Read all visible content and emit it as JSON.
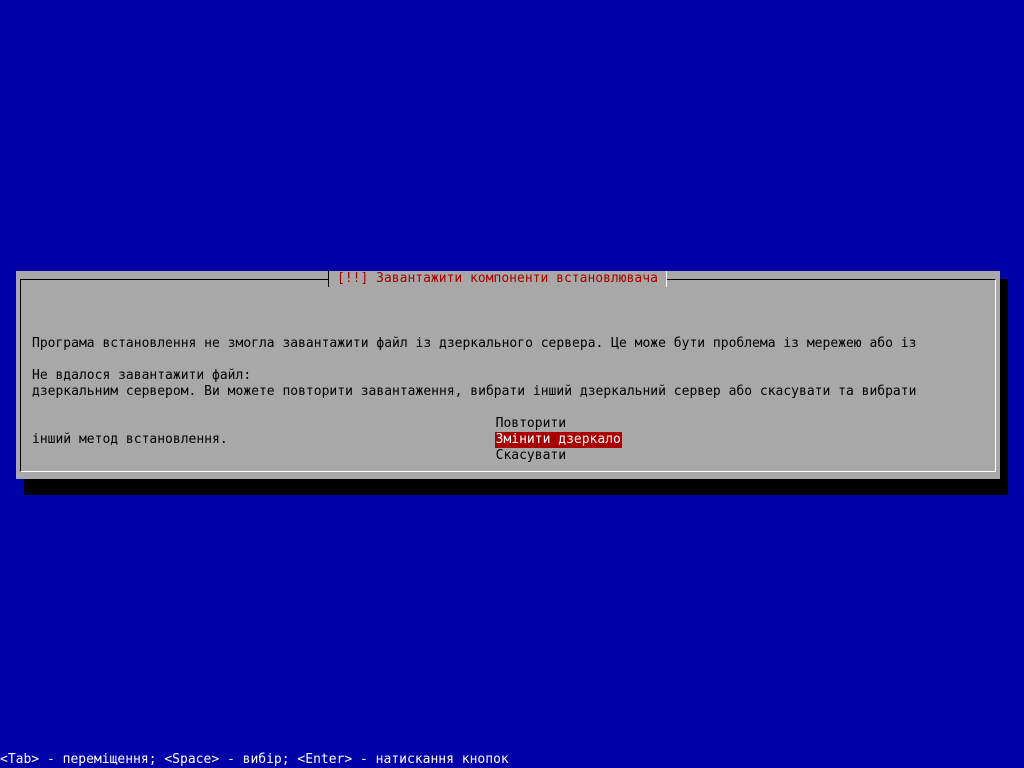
{
  "dialog": {
    "title": "[!!] Завантажити компоненти встановлювача",
    "message_lines": [
      "Програма встановлення не змогла завантажити файл із дзеркального сервера. Це може бути проблема із мережею або із",
      "дзеркальним сервером. Ви можете повторити завантаження, вибрати інший дзеркальний сервер або скасувати та вибрати",
      "інший метод встановлення."
    ],
    "prompt": "Не вдалося завантажити файл:",
    "options": [
      {
        "label": "Повторити",
        "selected": false
      },
      {
        "label": "Змінити дзеркало",
        "selected": true
      },
      {
        "label": "Скасувати",
        "selected": false
      }
    ]
  },
  "help_line": "<Tab> - переміщення; <Space> - вибір; <Enter> - натискання кнопок",
  "colors": {
    "background": "#0000a8",
    "dialog": "#a8a8a8",
    "title_text": "#a80000",
    "selection": "#a80000",
    "help_text": "#ffffff"
  }
}
